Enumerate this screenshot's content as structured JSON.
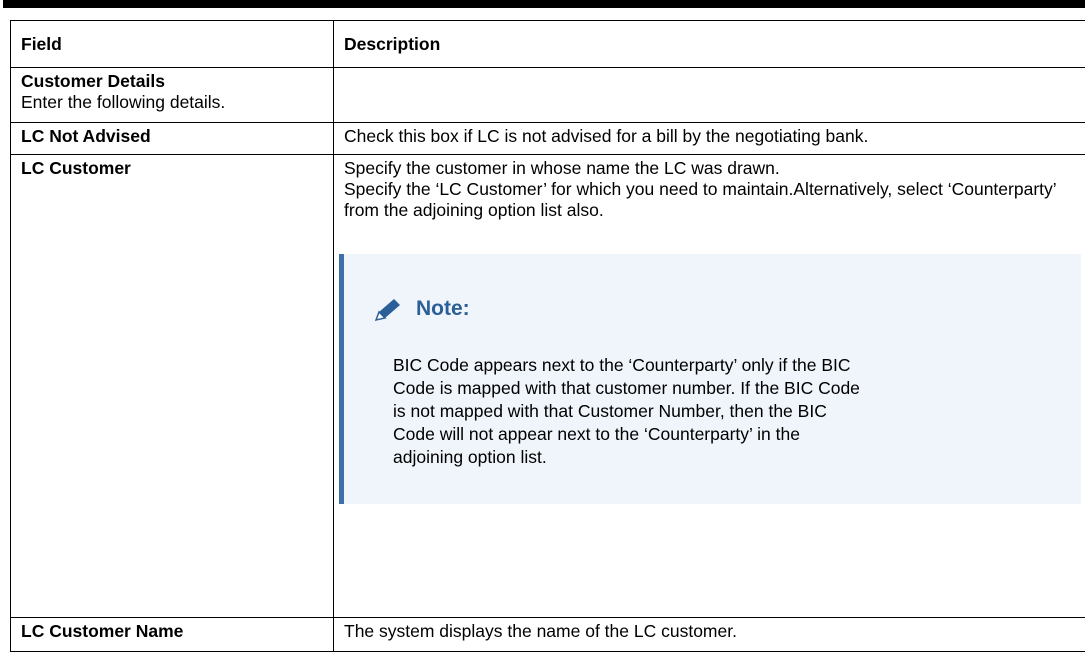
{
  "table": {
    "headers": {
      "field": "Field",
      "description": "Description"
    },
    "rows": [
      {
        "field": "Customer Details",
        "field_sub": "Enter the following details.",
        "description": ""
      },
      {
        "field": "LC Not Advised",
        "description": "Check this box if LC is not advised for a bill by the negotiating bank."
      },
      {
        "field": "LC Customer",
        "description_lines": [
          "Specify the customer in whose name the LC was drawn.",
          "Specify the ‘LC Customer’ for which you need to maintain.Alternatively, select ‘Counterparty’ from the adjoining option list also."
        ],
        "note": {
          "icon": "pencil-icon",
          "title": "Note:",
          "text": "BIC Code appears next to the ‘Counterparty’ only if the BIC Code is mapped with that customer number. If the BIC Code is not mapped with that Customer Number, then the BIC Code will not appear next to the ‘Counterparty’ in the adjoining option list."
        }
      },
      {
        "field": "LC Customer Name",
        "description": "The system displays the name of the LC customer."
      }
    ]
  },
  "colors": {
    "note_accent": "#3d6fa8",
    "note_title": "#2b5f97",
    "note_background": "#f0f5fb"
  }
}
